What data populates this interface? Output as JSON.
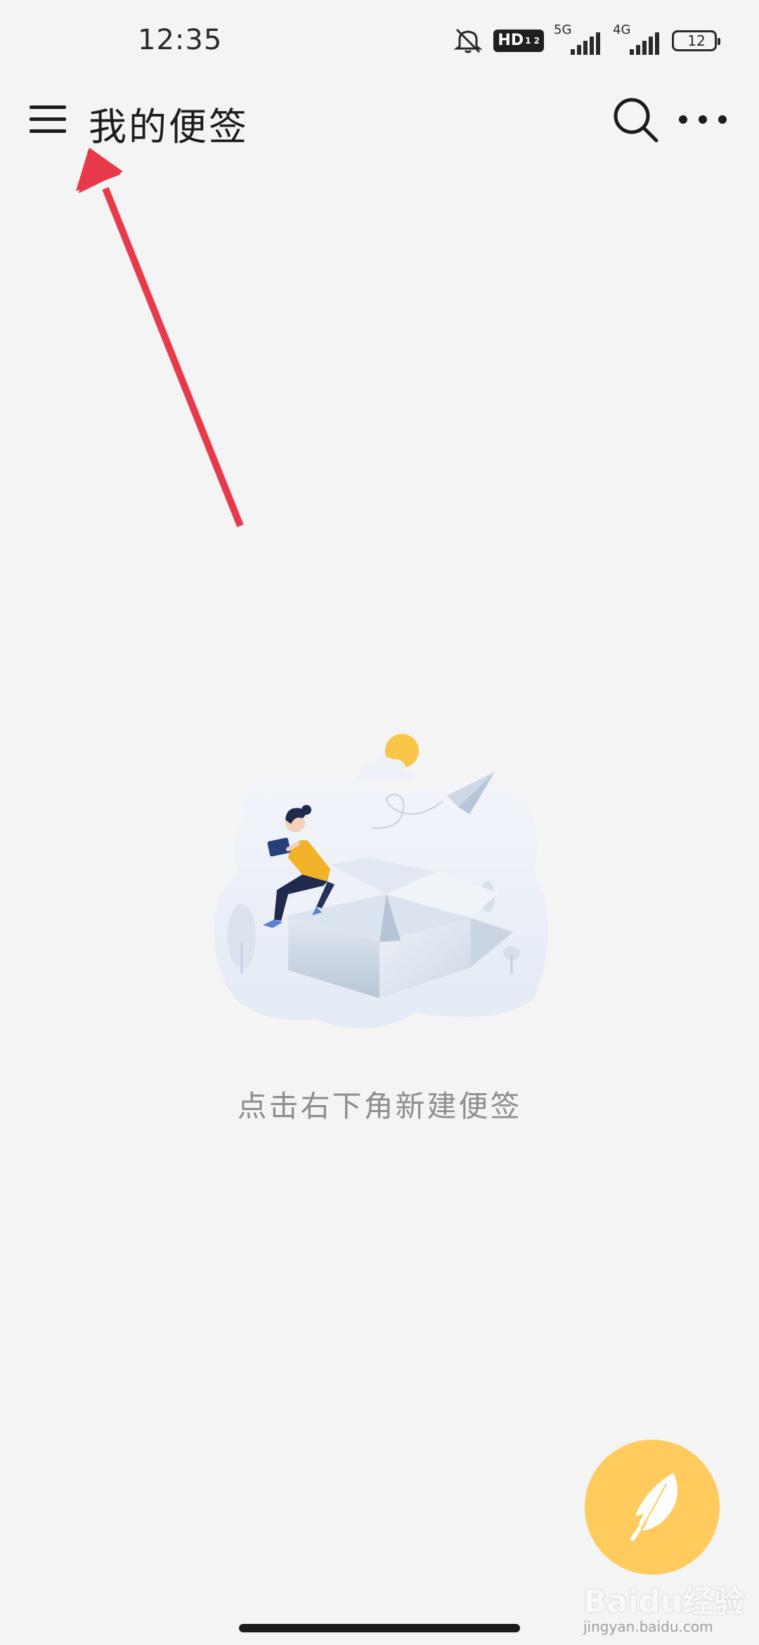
{
  "status_bar": {
    "time": "12:35",
    "hd_label": "HD",
    "hd_sub": "1 2",
    "sim1_network": "5G",
    "sim2_network": "4G",
    "battery_level": "12",
    "battery_color": "#e0332f",
    "icons": [
      "mute-icon",
      "hd-voice-icon",
      "signal-icon",
      "signal-icon",
      "battery-icon"
    ]
  },
  "app_bar": {
    "title": "我的便签",
    "menu_icon": "hamburger-menu-icon",
    "search_icon": "search-icon",
    "more_icon": "more-options-icon"
  },
  "annotation": {
    "arrow_color": "#e8394a"
  },
  "empty_state": {
    "illustration": "empty-box-illustration",
    "message": "点击右下角新建便签"
  },
  "fab": {
    "icon": "feather-pen-icon",
    "color": "#fecb5c"
  },
  "watermark": {
    "text": "Baidu经验",
    "subtext": "jingyan.baidu.com"
  }
}
